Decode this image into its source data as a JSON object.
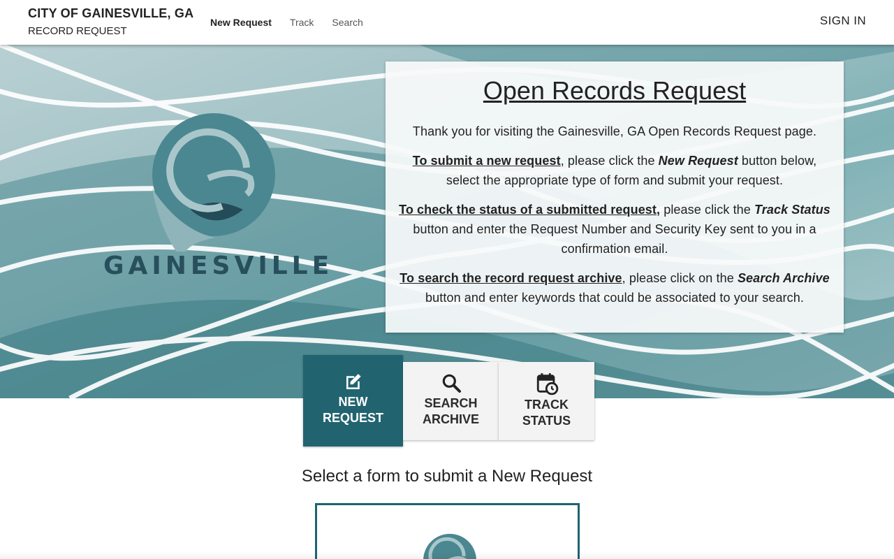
{
  "header": {
    "org_name": "CITY OF GAINESVILLE, GA",
    "app_name": "RECORD REQUEST",
    "nav": [
      {
        "label": "New Request",
        "active": true
      },
      {
        "label": "Track",
        "active": false
      },
      {
        "label": "Search",
        "active": false
      }
    ],
    "sign_in_label": "SIGN IN"
  },
  "hero": {
    "logo_wordmark": "GAINESVILLE",
    "card": {
      "title": "Open Records Request",
      "intro": "Thank you for visiting the Gainesville, GA Open Records Request page.",
      "submit": {
        "lead": "To submit a new request",
        "mid": ", please click the ",
        "emph": "New Request",
        "tail": " button below, select the appropriate type of form and submit your request."
      },
      "status": {
        "lead": "To check the status of a submitted request,",
        "mid": " please click the ",
        "emph": "Track Status",
        "tail": " button and enter the Request Number and Security Key sent to you in a confirmation email."
      },
      "archive": {
        "lead": "To search the record request archive",
        "mid": ", please click on the ",
        "emph": "Search Archive",
        "tail": " button and enter keywords that could be associated to your search."
      }
    }
  },
  "tiles": [
    {
      "line1": "NEW",
      "line2": "REQUEST",
      "icon": "edit-icon",
      "selected": true
    },
    {
      "line1": "SEARCH",
      "line2": "ARCHIVE",
      "icon": "search-icon",
      "selected": false
    },
    {
      "line1": "TRACK",
      "line2": "STATUS",
      "icon": "calendar-clock-icon",
      "selected": false
    }
  ],
  "forms_section": {
    "heading": "Select a form to submit a New Request"
  },
  "colors": {
    "primary": "#216470",
    "logo_teal": "#4b8790",
    "logo_dark": "#234b58"
  }
}
